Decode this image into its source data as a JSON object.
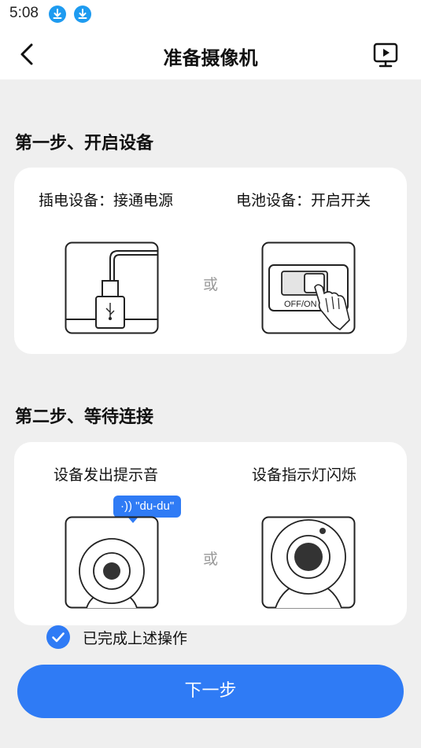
{
  "status_bar": {
    "time": "5:08",
    "notification_icons": [
      "download-icon",
      "download-icon"
    ]
  },
  "header": {
    "title": "准备摄像机",
    "back_icon": "chevron-left-icon",
    "video_icon": "video-tutorial-icon"
  },
  "step1": {
    "title": "第一步、开启设备",
    "left_label": "插电设备：接通电源",
    "right_label": "电池设备：开启开关",
    "or": "或",
    "switch_text": "OFF/ON"
  },
  "step2": {
    "title": "第二步、等待连接",
    "left_label": "设备发出提示音",
    "right_label": "设备指示灯闪烁",
    "or": "或",
    "bubble": "\"du-du\""
  },
  "confirm": {
    "label": "已完成上述操作",
    "checked": true
  },
  "next_button": {
    "label": "下一步"
  },
  "colors": {
    "accent": "#2f7bf5",
    "background": "#efefef",
    "card": "#ffffff",
    "download_icon": "#1e9bf0"
  }
}
